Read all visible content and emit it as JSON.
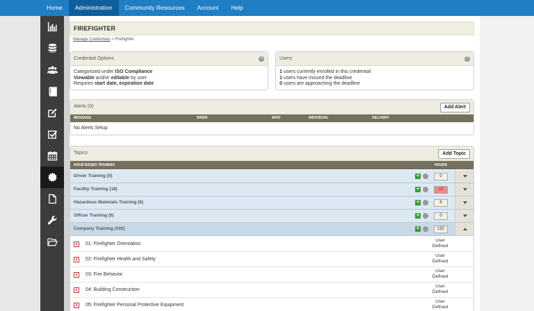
{
  "nav": {
    "items": [
      {
        "label": "Home",
        "active": false
      },
      {
        "label": "Administration",
        "active": true
      },
      {
        "label": "Community Resources",
        "active": false
      },
      {
        "label": "Account",
        "active": false
      },
      {
        "label": "Help",
        "active": false
      }
    ]
  },
  "sidebar": {
    "icons": [
      "bar-chart-icon",
      "database-icon",
      "users-icon",
      "book-icon",
      "edit-icon",
      "checkbox-icon",
      "calendar-icon",
      "certificate-icon",
      "document-icon",
      "wrench-icon",
      "folder-open-icon"
    ],
    "active_index": 7
  },
  "page": {
    "title": "FIREFIGHTER"
  },
  "breadcrumb": {
    "link": "Manage Credentials",
    "separator": ">",
    "current": "Firefighter"
  },
  "credential_options": {
    "title": "Credential Options",
    "line1_prefix": "Categorized under ",
    "line1_bold": "ISO Compliance",
    "line2_bold1": "Viewable",
    "line2_mid": " and/or ",
    "line2_bold2": "editable",
    "line2_suffix": " by user",
    "line3_prefix": "Requires ",
    "line3_bold": "start date, expiration date"
  },
  "users_panel": {
    "title": "Users",
    "lines": [
      {
        "count": "1",
        "text": " users currently enrolled in this credential"
      },
      {
        "count": "1",
        "text": " users have missed the deadline"
      },
      {
        "count": "0",
        "text": " users are approaching the deadline"
      }
    ]
  },
  "alerts": {
    "title": "Alerts (0)",
    "add_button": "Add Alert",
    "columns": [
      "MESSAGE",
      "WHEN",
      "WHO",
      "INDIVIDUAL",
      "DELIVERY"
    ],
    "empty": "No Alerts Setup"
  },
  "topics": {
    "title": "Topics",
    "add_button": "Add Topic",
    "header_label": "HOUR BASED TRAINING",
    "header_hours": "HOURS",
    "rows": [
      {
        "name": "Driver Training (0)",
        "hours": "0",
        "warn": false,
        "expanded": false
      },
      {
        "name": "Facility Training (18)",
        "hours": "18",
        "warn": true,
        "expanded": false
      },
      {
        "name": "Hazardous Materials Training (6)",
        "hours": "6",
        "warn": false,
        "expanded": false
      },
      {
        "name": "Officer Training (0)",
        "hours": "0",
        "warn": false,
        "expanded": false
      },
      {
        "name": "Company Training (192)",
        "hours": "192",
        "warn": false,
        "expanded": true
      }
    ],
    "items": [
      {
        "name": "01: Firefighter Orientation",
        "user_line1": "User",
        "user_line2": "Defined"
      },
      {
        "name": "02: Firefighter Health and Safety",
        "user_line1": "User",
        "user_line2": "Defined"
      },
      {
        "name": "03: Fire Behavior",
        "user_line1": "User",
        "user_line2": "Defined"
      },
      {
        "name": "04: Building Construction",
        "user_line1": "User",
        "user_line2": "Defined"
      },
      {
        "name": "05: Firefighter Personal Protective Equipment",
        "user_line1": "User",
        "user_line2": "Defined"
      }
    ]
  },
  "colors": {
    "nav": "#1f7ec4",
    "nav_active": "#0f5f9e",
    "sidebar": "#3c3c3c",
    "topic_row": "#dce8f2",
    "warn": "#f08a8a",
    "plus": "#3a9a3a"
  }
}
